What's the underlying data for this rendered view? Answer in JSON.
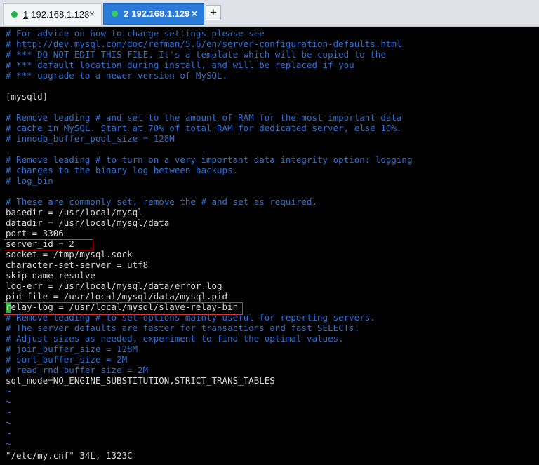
{
  "tabs": [
    {
      "number": "1",
      "host": "192.168.1.128",
      "close": "×"
    },
    {
      "number": "2",
      "host": "192.168.1.129",
      "close": "×"
    }
  ],
  "new_tab_label": "+",
  "lines": [
    {
      "text": "# For advice on how to change settings please see",
      "kind": "comment"
    },
    {
      "text": "# http://dev.mysql.com/doc/refman/5.6/en/server-configuration-defaults.html",
      "kind": "comment"
    },
    {
      "text": "# *** DO NOT EDIT THIS FILE. It's a template which will be copied to the",
      "kind": "comment"
    },
    {
      "text": "# *** default location during install, and will be replaced if you",
      "kind": "comment"
    },
    {
      "text": "# *** upgrade to a newer version of MySQL.",
      "kind": "comment"
    },
    {
      "text": "",
      "kind": "plain"
    },
    {
      "text": "[mysqld]",
      "kind": "plain"
    },
    {
      "text": "",
      "kind": "plain"
    },
    {
      "text": "# Remove leading # and set to the amount of RAM for the most important data",
      "kind": "comment"
    },
    {
      "text": "# cache in MySQL. Start at 70% of total RAM for dedicated server, else 10%.",
      "kind": "comment"
    },
    {
      "text": "# innodb_buffer_pool_size = 128M",
      "kind": "comment"
    },
    {
      "text": "",
      "kind": "plain"
    },
    {
      "text": "# Remove leading # to turn on a very important data integrity option: logging",
      "kind": "comment"
    },
    {
      "text": "# changes to the binary log between backups.",
      "kind": "comment"
    },
    {
      "text": "# log_bin",
      "kind": "comment"
    },
    {
      "text": "",
      "kind": "plain"
    },
    {
      "text": "# These are commonly set, remove the # and set as required.",
      "kind": "comment"
    },
    {
      "text": "basedir = /usr/local/mysql",
      "kind": "plain"
    },
    {
      "text": "datadir = /usr/local/mysql/data",
      "kind": "plain"
    },
    {
      "text": "port = 3306",
      "kind": "plain"
    },
    {
      "text": "server_id = 2",
      "kind": "plain"
    },
    {
      "text": "socket = /tmp/mysql.sock",
      "kind": "plain"
    },
    {
      "text": "character-set-server = utf8",
      "kind": "plain"
    },
    {
      "text": "skip-name-resolve",
      "kind": "plain"
    },
    {
      "text": "log-err = /usr/local/mysql/data/error.log",
      "kind": "plain"
    },
    {
      "text": "pid-file = /usr/local/mysql/data/mysql.pid",
      "kind": "plain"
    },
    {
      "text": "relay-log = /usr/local/mysql/slave-relay-bin",
      "kind": "plain"
    },
    {
      "text": "# Remove leading # to set options mainly useful for reporting servers.",
      "kind": "comment"
    },
    {
      "text": "# The server defaults are faster for transactions and fast SELECTs.",
      "kind": "comment"
    },
    {
      "text": "# Adjust sizes as needed, experiment to find the optimal values.",
      "kind": "comment"
    },
    {
      "text": "# join_buffer_size = 128M",
      "kind": "comment"
    },
    {
      "text": "# sort_buffer_size = 2M",
      "kind": "comment"
    },
    {
      "text": "# read_rnd_buffer_size = 2M",
      "kind": "comment"
    },
    {
      "text": "sql_mode=NO_ENGINE_SUBSTITUTION,STRICT_TRANS_TABLES",
      "kind": "plain"
    },
    {
      "text": "~",
      "kind": "tilde"
    },
    {
      "text": "~",
      "kind": "tilde"
    },
    {
      "text": "~",
      "kind": "tilde"
    },
    {
      "text": "~",
      "kind": "tilde"
    },
    {
      "text": "~",
      "kind": "tilde"
    },
    {
      "text": "~",
      "kind": "tilde"
    },
    {
      "text": "\"/etc/my.cnf\" 34L, 1323C",
      "kind": "plain"
    }
  ],
  "colors": {
    "comment": "#2f6fd1",
    "plain": "#d8d8d8",
    "highlight_box": "#dd3333",
    "cursor": "#3aaf3a"
  }
}
